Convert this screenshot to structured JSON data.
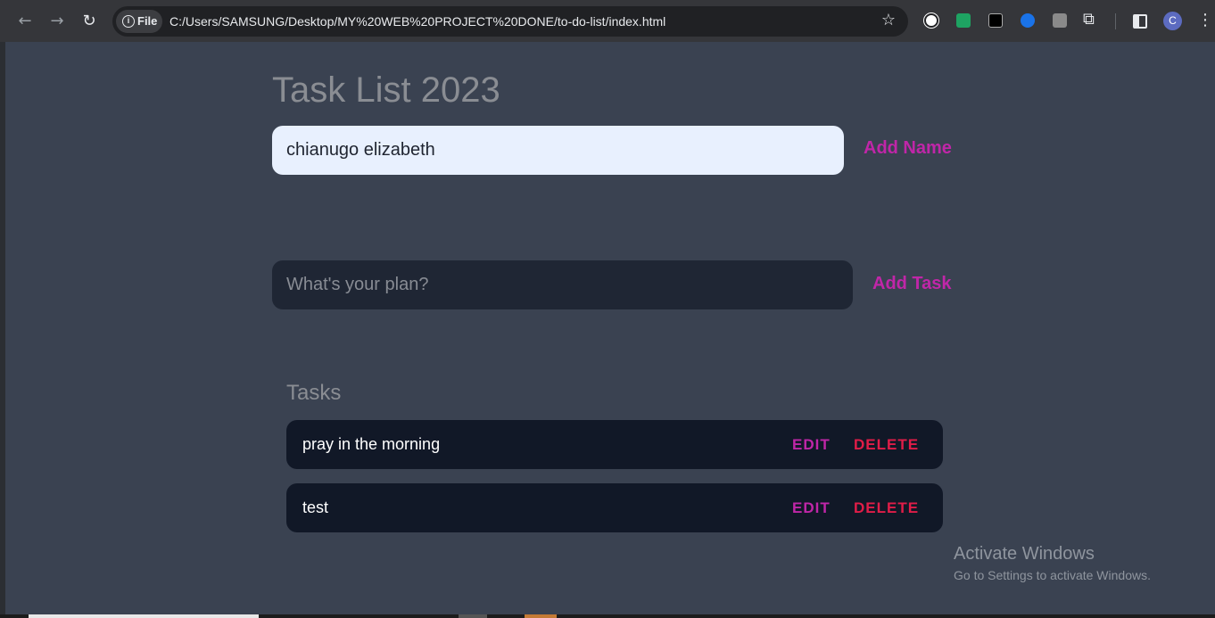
{
  "browser": {
    "site_chip": "File",
    "url": "C:/Users/SAMSUNG/Desktop/MY%20WEB%20PROJECT%20DONE/to-do-list/index.html",
    "avatar_letter": "C",
    "icons": [
      "back-icon",
      "forward-icon",
      "reload-icon",
      "info-icon",
      "star-icon",
      "extension-icon",
      "puzzle-icon",
      "side-panel-icon",
      "menu-icon"
    ]
  },
  "app": {
    "title": "Task List 2023",
    "name_input_value": "chianugo elizabeth",
    "add_name_label": "Add Name",
    "task_input_placeholder": "What's your plan?",
    "add_task_label": "Add Task",
    "tasks_heading": "Tasks",
    "tasks": [
      {
        "text": "pray in the morning",
        "edit_label": "EDIT",
        "delete_label": "DELETE"
      },
      {
        "text": "test",
        "edit_label": "EDIT",
        "delete_label": "DELETE"
      }
    ],
    "colors": {
      "background": "#3a4251",
      "accent": "#c026a8",
      "danger": "#e11d48",
      "task_card": "#111827"
    }
  },
  "watermark": {
    "title": "Activate Windows",
    "subtitle": "Go to Settings to activate Windows."
  }
}
